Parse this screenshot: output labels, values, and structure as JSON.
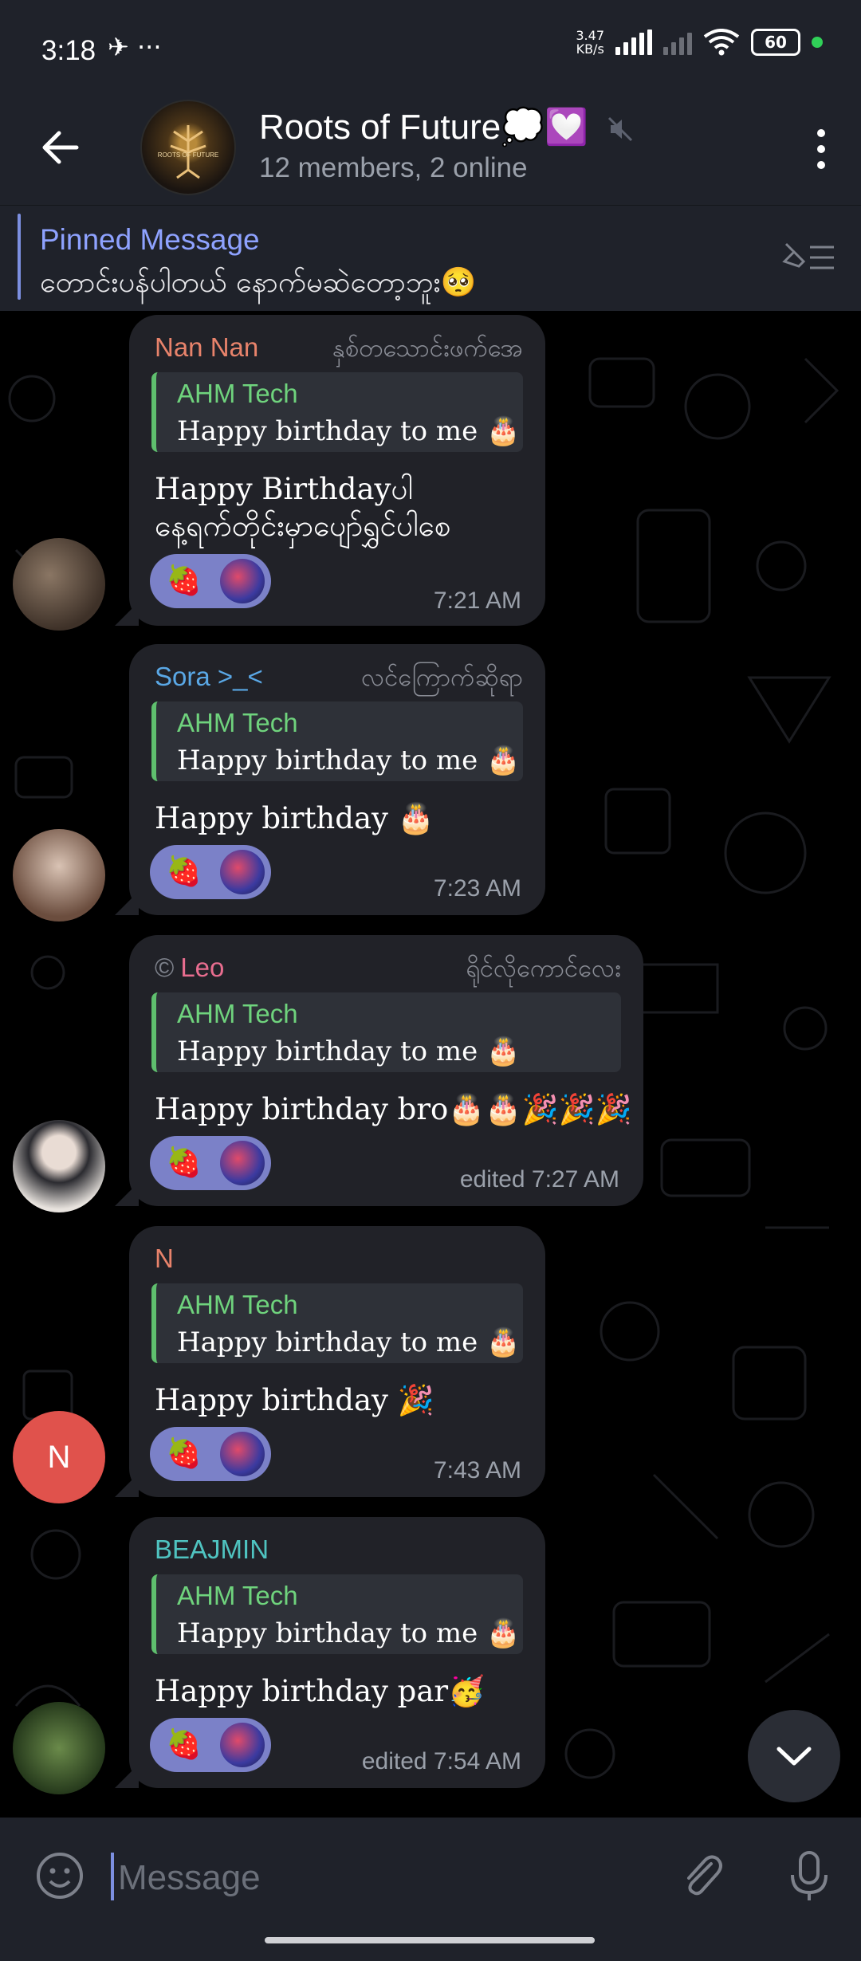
{
  "status_bar": {
    "time": "3:18",
    "left_icons": "✈ ···",
    "speed": "3.47",
    "speed_unit": "KB/s",
    "battery": "60"
  },
  "header": {
    "title": "Roots of Future💭💟",
    "subtitle": "12 members, 2 online",
    "avatar_text": "ROOTS OF FUTURE"
  },
  "pinned": {
    "title": "Pinned Message",
    "text": "တောင်းပန်ပါတယ် နောက်မဆဲတော့ဘူး🥺"
  },
  "messages": [
    {
      "name": "Nan Nan",
      "name_color": "#e8836b",
      "role": "နှစ်တသောင်းဖက်အေ",
      "quote_name": "AHM Tech",
      "quote_text": "Happy birthday  to me 🎂",
      "body": "Happy Birthdayပါ\nနေ့ရက်တိုင်းမှာပျော်ရွှင်ပါစေ",
      "time": "7:21 AM"
    },
    {
      "name": "Sora >_<",
      "name_color": "#5aa8e6",
      "role": "လင်ကြောက်ဆိုရာ",
      "quote_name": "AHM Tech",
      "quote_text": "Happy birthday  to me 🎂",
      "body": "Happy birthday 🎂",
      "time": "7:23 AM"
    },
    {
      "name": "Leo",
      "name_prefix": "©",
      "name_color": "#e86d8f",
      "role": "ရိုင်လိုကောင်လေး",
      "quote_name": "AHM Tech",
      "quote_text": "Happy birthday  to me 🎂",
      "body": "Happy birthday bro🎂🎂🎉🎉🎉",
      "time": "edited 7:27 AM"
    },
    {
      "name": "N",
      "name_color": "#e8836b",
      "role": "",
      "quote_name": "AHM Tech",
      "quote_text": "Happy birthday  to me 🎂",
      "body": "Happy birthday 🎉",
      "time": "7:43 AM",
      "avatar_letter": "N"
    },
    {
      "name": "BEAJMIN",
      "name_color": "#4fc3c0",
      "role": "",
      "quote_name": "AHM Tech",
      "quote_text": "Happy birthday  to me 🎂",
      "body": "Happy birthday par🥳",
      "time": "edited 7:54 AM"
    }
  ],
  "reaction_emoji": "🍓",
  "input": {
    "placeholder": "Message"
  },
  "colors": {
    "bar_bg": "#1f222a",
    "bubble_bg": "#212228",
    "accent": "#8ea2ff",
    "quote_accent": "#6fd37d"
  }
}
